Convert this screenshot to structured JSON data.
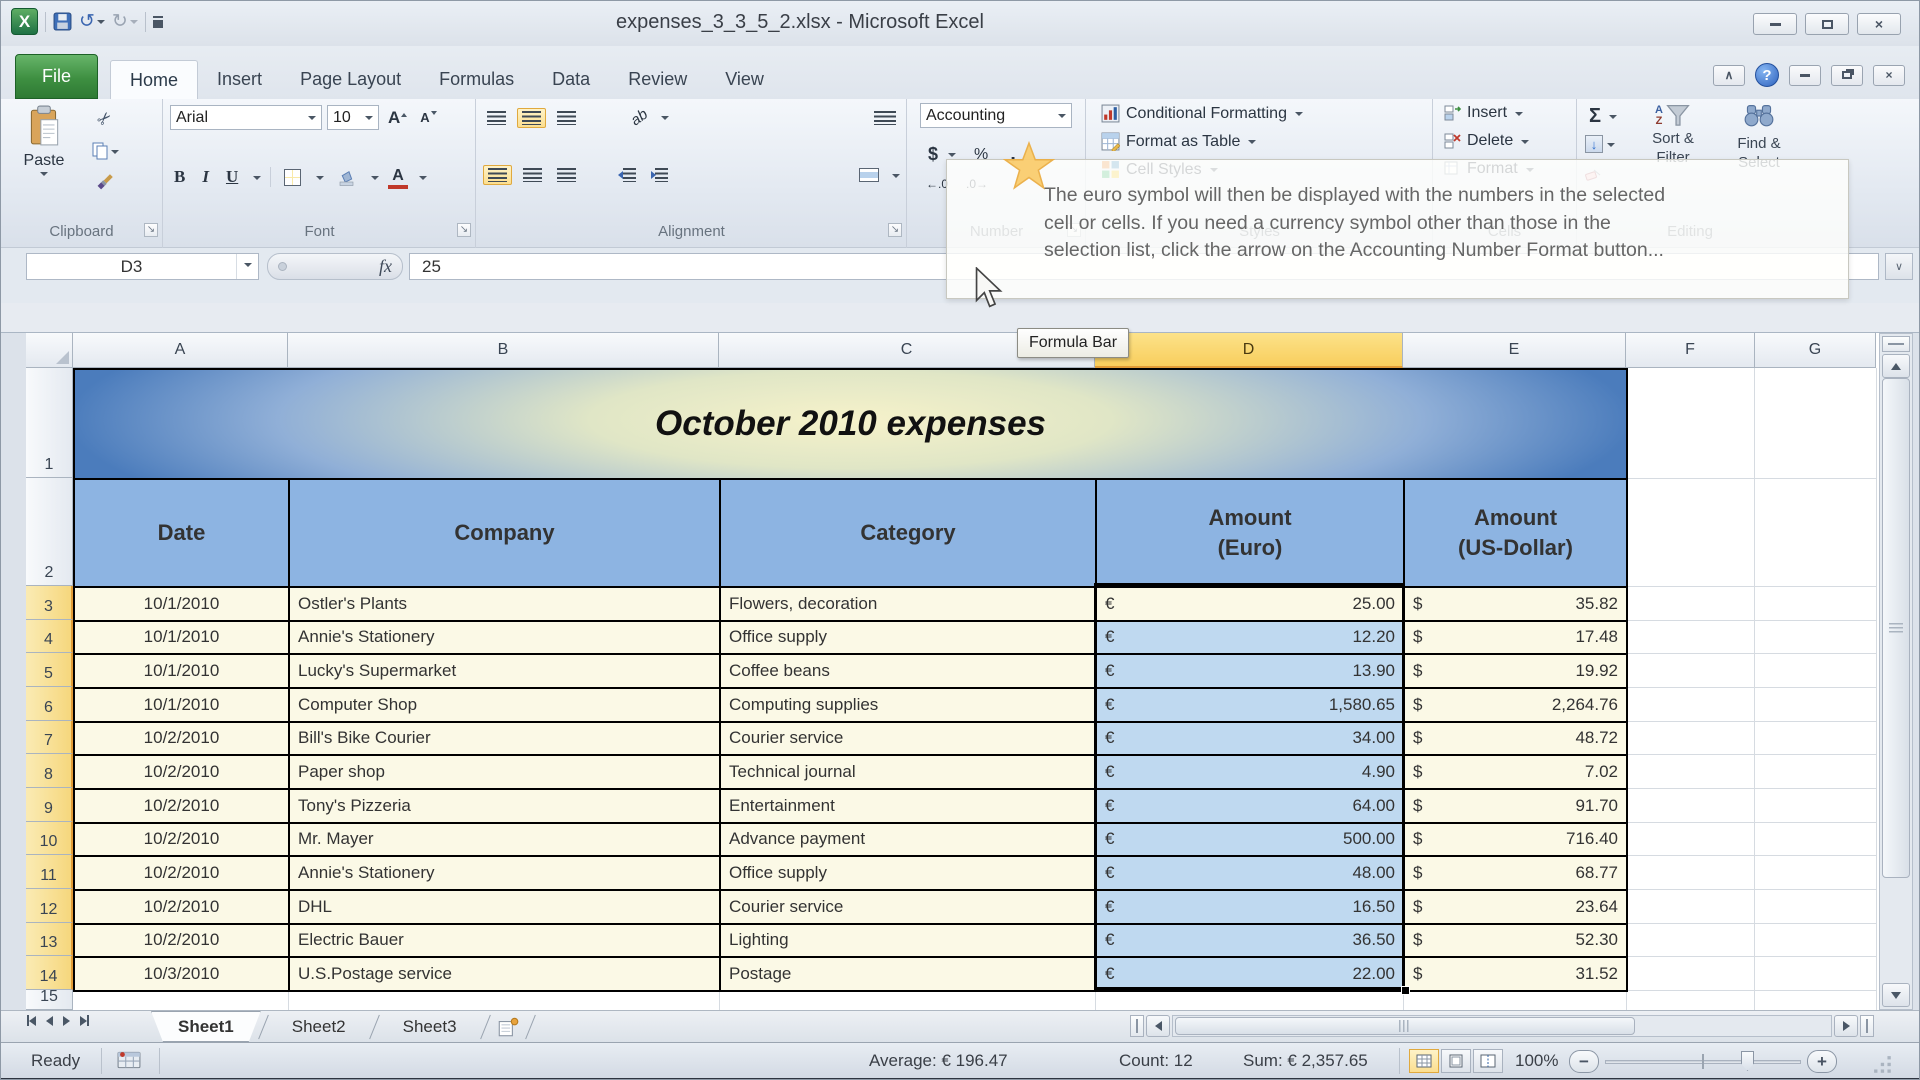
{
  "window": {
    "title": "expenses_3_3_5_2.xlsx  -  Microsoft Excel"
  },
  "tabs": [
    "File",
    "Home",
    "Insert",
    "Page Layout",
    "Formulas",
    "Data",
    "Review",
    "View"
  ],
  "active_tab": "Home",
  "ribbon": {
    "clipboard": {
      "label": "Clipboard",
      "paste": "Paste"
    },
    "font": {
      "label": "Font",
      "family": "Arial",
      "size": "10",
      "bold": "B",
      "italic": "I",
      "underline": "U"
    },
    "alignment": {
      "label": "Alignment",
      "orientation": "ab"
    },
    "number": {
      "label": "Number",
      "format": "Accounting",
      "currency": "$",
      "percent": "%",
      "comma": ",",
      "inc_decimal": "←.0",
      "dec_decimal": ".0→"
    },
    "styles": {
      "label": "Styles",
      "conditional": "Conditional Formatting",
      "format_table": "Format as Table",
      "cell_styles": "Cell Styles"
    },
    "cells": {
      "label": "Cells",
      "insert": "Insert",
      "delete": "Delete",
      "format": "Format"
    },
    "editing": {
      "label": "Editing",
      "autosum": "Σ",
      "sort1": "Sort &",
      "sort2": "Filter",
      "find1": "Find &",
      "find2": "Select"
    }
  },
  "tooltip": {
    "line1": "The euro symbol will then be displayed with the numbers in the selected",
    "line2": "cell or cells. If you need a currency symbol other than those in the",
    "line3": "selection list, click the arrow on the Accounting Number Format button..."
  },
  "formula_bar": {
    "name_box": "D3",
    "fx": "fx",
    "value": "25",
    "bar_tooltip": "Formula Bar"
  },
  "sheet": {
    "columns": [
      "A",
      "B",
      "C",
      "D",
      "E",
      "F",
      "G"
    ],
    "selected_column": "D",
    "active_cell": "D3",
    "title": "October 2010 expenses",
    "headers": [
      "Date",
      "Company",
      "Category",
      "Amount\n(Euro)",
      "Amount\n(US-Dollar)"
    ],
    "euro": "€",
    "dollar": "$",
    "rows": [
      {
        "n": "3",
        "date": "10/1/2010",
        "company": "Ostler's Plants",
        "category": "Flowers, decoration",
        "euro": "25.00",
        "usd": "35.82"
      },
      {
        "n": "4",
        "date": "10/1/2010",
        "company": "Annie's Stationery",
        "category": "Office supply",
        "euro": "12.20",
        "usd": "17.48"
      },
      {
        "n": "5",
        "date": "10/1/2010",
        "company": "Lucky's Supermarket",
        "category": "Coffee beans",
        "euro": "13.90",
        "usd": "19.92"
      },
      {
        "n": "6",
        "date": "10/1/2010",
        "company": "Computer Shop",
        "category": "Computing supplies",
        "euro": "1,580.65",
        "usd": "2,264.76"
      },
      {
        "n": "7",
        "date": "10/2/2010",
        "company": "Bill's Bike Courier",
        "category": "Courier service",
        "euro": "34.00",
        "usd": "48.72"
      },
      {
        "n": "8",
        "date": "10/2/2010",
        "company": "Paper shop",
        "category": "Technical journal",
        "euro": "4.90",
        "usd": "7.02"
      },
      {
        "n": "9",
        "date": "10/2/2010",
        "company": "Tony's Pizzeria",
        "category": "Entertainment",
        "euro": "64.00",
        "usd": "91.70"
      },
      {
        "n": "10",
        "date": "10/2/2010",
        "company": "Mr. Mayer",
        "category": "Advance payment",
        "euro": "500.00",
        "usd": "716.40"
      },
      {
        "n": "11",
        "date": "10/2/2010",
        "company": "Annie's Stationery",
        "category": "Office supply",
        "euro": "48.00",
        "usd": "68.77"
      },
      {
        "n": "12",
        "date": "10/2/2010",
        "company": "DHL",
        "category": "Courier service",
        "euro": "16.50",
        "usd": "23.64"
      },
      {
        "n": "13",
        "date": "10/2/2010",
        "company": "Electric Bauer",
        "category": "Lighting",
        "euro": "36.50",
        "usd": "52.30"
      },
      {
        "n": "14",
        "date": "10/3/2010",
        "company": "U.S.Postage service",
        "category": "Postage",
        "euro": "22.00",
        "usd": "31.52"
      }
    ]
  },
  "sheet_tabs": {
    "tabs": [
      "Sheet1",
      "Sheet2",
      "Sheet3"
    ],
    "active": "Sheet1"
  },
  "status_bar": {
    "mode": "Ready",
    "average": "Average: € 196.47",
    "count": "Count: 12",
    "sum": "Sum: € 2,357.65",
    "zoom": "100%"
  }
}
